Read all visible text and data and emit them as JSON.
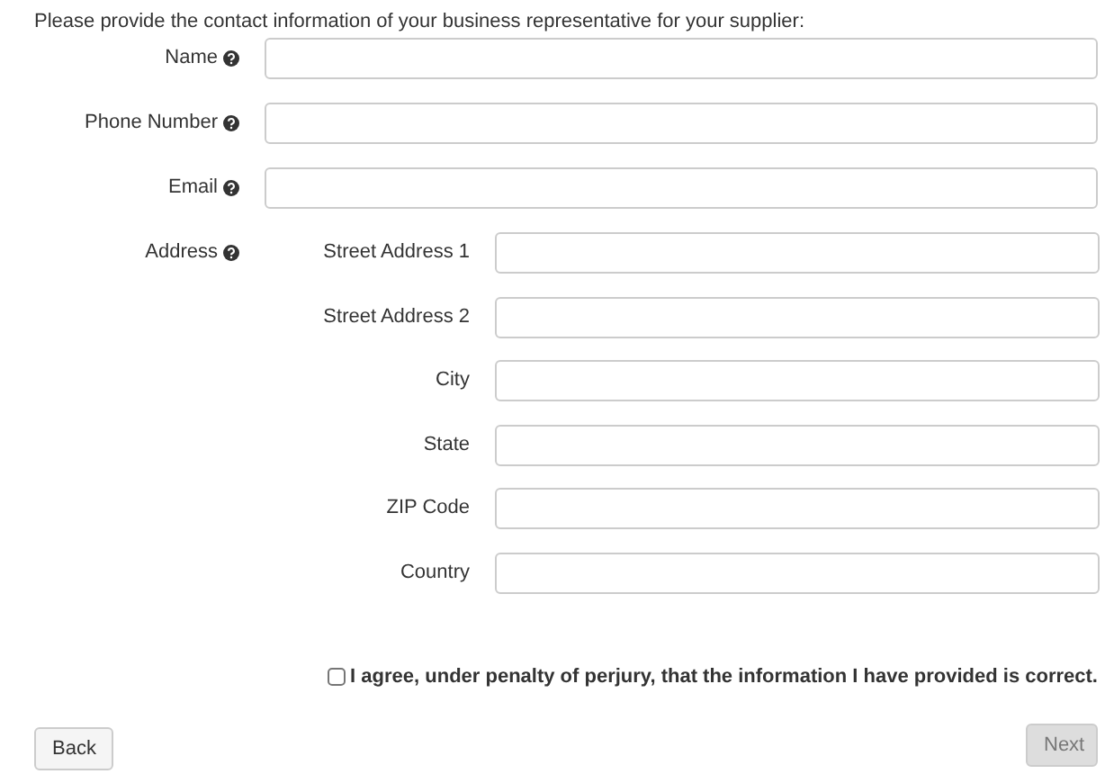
{
  "intro": "Please provide the contact information of your business representative for your supplier:",
  "fields": [
    {
      "label": "Name",
      "help": true
    },
    {
      "label": "Phone Number",
      "help": true
    },
    {
      "label": "Email",
      "help": true
    }
  ],
  "address": {
    "label": "Address",
    "help": true,
    "fields": [
      {
        "label": "Street Address 1"
      },
      {
        "label": "Street Address 2"
      },
      {
        "label": "City"
      },
      {
        "label": "State"
      },
      {
        "label": "ZIP Code"
      },
      {
        "label": "Country"
      }
    ]
  },
  "agreement": {
    "label": "I agree, under penalty of perjury, that the information I have provided is correct.",
    "checked": false
  },
  "buttons": [
    {
      "label": "Back",
      "disabled": false
    },
    {
      "label": "Next",
      "disabled": true
    }
  ]
}
